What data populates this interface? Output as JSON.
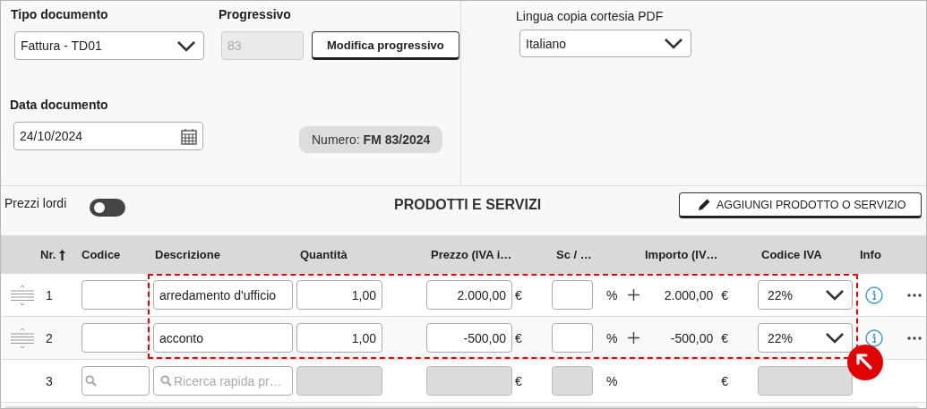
{
  "document_type": {
    "label": "Tipo documento",
    "value": "Fattura - TD01"
  },
  "progressive": {
    "label": "Progressivo",
    "value": "83",
    "disabled": true
  },
  "edit_progressive_button": "Modifica progressivo",
  "document_date": {
    "label": "Data documento",
    "value": "24/10/2024"
  },
  "number_badge": "Numero: **FM 83/2024**",
  "pdf_language": {
    "label": "Lingua copia cortesia PDF",
    "value": "Italiano"
  },
  "gross_prices": {
    "label": "Prezzi lordi",
    "on": false
  },
  "section_title": "PRODOTTI E SERVIZI",
  "add_button": "AGGIUNGI PRODOTTO O SERVIZIO",
  "table": {
    "columns": [
      {
        "label": "Nr.",
        "sorted": true
      },
      {
        "label": "Codice",
        "sorted": false
      },
      {
        "label": "Descrizione",
        "sorted": false
      },
      {
        "label": "Quantità",
        "sorted": false
      },
      {
        "label": "Prezzo (IVA i…",
        "sorted": false
      },
      {
        "label": "Sc / …",
        "sorted": false
      },
      {
        "label": "Importo (IV…",
        "sorted": false
      },
      {
        "label": "Codice IVA",
        "sorted": false
      },
      {
        "label": "Info",
        "sorted": false
      }
    ],
    "rows": [
      {
        "kind": "item",
        "nr": "1",
        "description": "arredamento d'ufficio",
        "quantity": "1,00",
        "price": "2.000,00",
        "price_currency": "€",
        "discount_unit": "%",
        "amount": "2.000,00",
        "amount_currency": "€",
        "vat": "22%"
      },
      {
        "kind": "item",
        "nr": "2",
        "description": "acconto",
        "quantity": "1,00",
        "price": "-500,00",
        "price_currency": "€",
        "discount_unit": "%",
        "amount": "-500,00",
        "amount_currency": "€",
        "vat": "22%"
      },
      {
        "kind": "new",
        "nr": "3",
        "description_placeholder": "Ricerca rapida pr…",
        "price_currency": "€",
        "discount_unit": "%",
        "amount_currency": "€"
      }
    ]
  }
}
